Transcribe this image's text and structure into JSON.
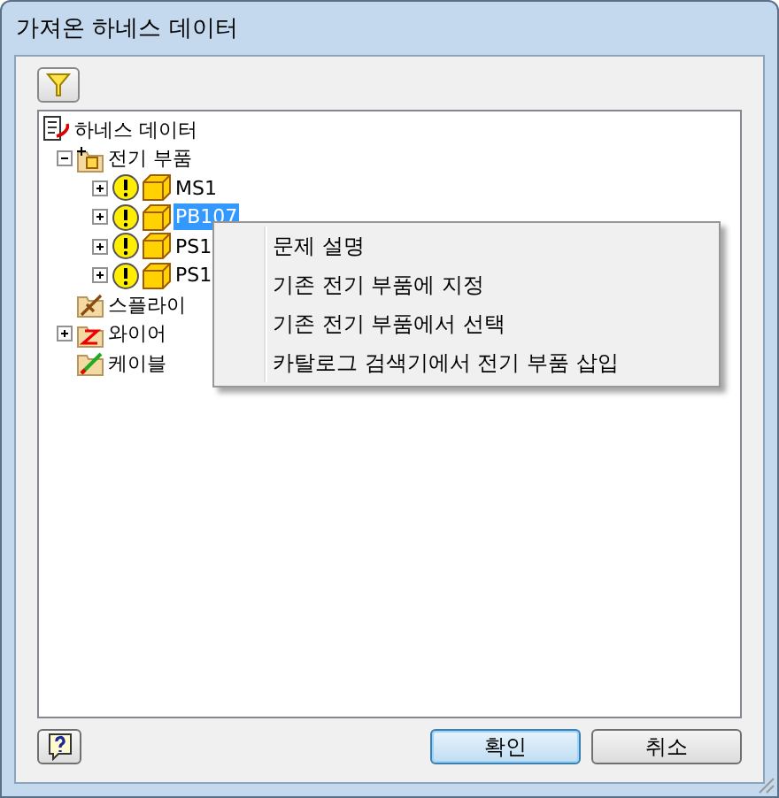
{
  "window": {
    "title": "가져온 하네스 데이터"
  },
  "tree": {
    "label": "하네스 데이터",
    "kind": "harness",
    "selected": false,
    "children": [
      {
        "label": "전기 부품",
        "kind": "parts-folder",
        "expanded": true,
        "selected": false,
        "children": [
          {
            "label": "MS1",
            "kind": "part",
            "expanded": false,
            "selected": false
          },
          {
            "label": "PB107",
            "kind": "part",
            "expanded": false,
            "selected": true
          },
          {
            "label": "PS1",
            "kind": "part",
            "expanded": false,
            "selected": false
          },
          {
            "label": "PS1",
            "kind": "part",
            "expanded": false,
            "selected": false
          }
        ]
      },
      {
        "label": "스플라이",
        "kind": "splice",
        "selected": false
      },
      {
        "label": "와이어",
        "kind": "wire",
        "expanded": false,
        "selected": false
      },
      {
        "label": "케이블",
        "kind": "cable",
        "selected": false
      }
    ]
  },
  "context_menu": {
    "items": [
      {
        "label": "문제 설명"
      },
      {
        "label": "기존 전기 부품에 지정"
      },
      {
        "label": "기존 전기 부품에서 선택"
      },
      {
        "label": "카탈로그 검색기에서 전기 부품 삽입"
      }
    ]
  },
  "buttons": [
    {
      "label": "확인",
      "default": true
    },
    {
      "label": "취소",
      "default": false
    }
  ]
}
